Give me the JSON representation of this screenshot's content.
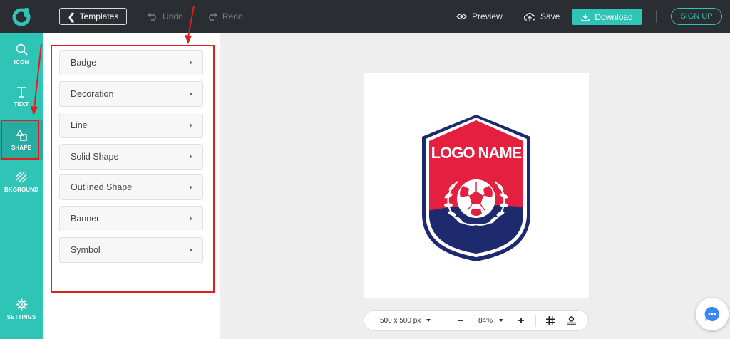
{
  "toolbar": {
    "templates_label": "Templates",
    "undo_label": "Undo",
    "redo_label": "Redo",
    "preview_label": "Preview",
    "save_label": "Save",
    "download_label": "Download",
    "signup_label": "SIGN UP"
  },
  "sidebar": {
    "items": [
      {
        "label": "ICON",
        "icon": "search-icon"
      },
      {
        "label": "TEXT",
        "icon": "text-icon"
      },
      {
        "label": "SHAPE",
        "icon": "shapes-icon",
        "active": true
      },
      {
        "label": "BKGROUND",
        "icon": "background-icon"
      }
    ],
    "settings_label": "SETTINGS"
  },
  "shape_panel": {
    "categories": [
      "Badge",
      "Decoration",
      "Line",
      "Solid Shape",
      "Outlined Shape",
      "Banner",
      "Symbol"
    ]
  },
  "canvas": {
    "logo_text": "LOGO NAME",
    "background": "#ffffff"
  },
  "bottombar": {
    "size_label": "500 x 500 px",
    "zoom_label": "84%"
  },
  "colors": {
    "accent": "#2ec4b6",
    "topbar": "#2a2e33",
    "highlight": "#e01e1e",
    "crest_red": "#e51f3f",
    "crest_navy": "#1e2a6e"
  }
}
